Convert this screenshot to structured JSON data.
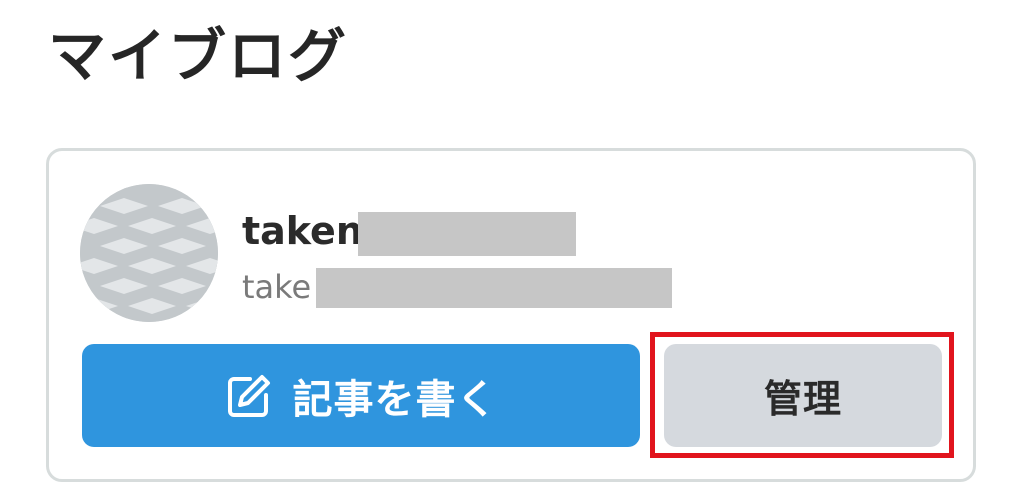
{
  "page": {
    "title": "マイブログ"
  },
  "blog_card": {
    "username_visible": "taken",
    "user_id_visible": "take",
    "write_button": {
      "icon": "edit-icon",
      "label": "記事を書く",
      "color": "#2f95de"
    },
    "manage_button": {
      "label": "管理",
      "color": "#d5d9de",
      "highlighted": true,
      "highlight_color": "#e1141d"
    }
  }
}
